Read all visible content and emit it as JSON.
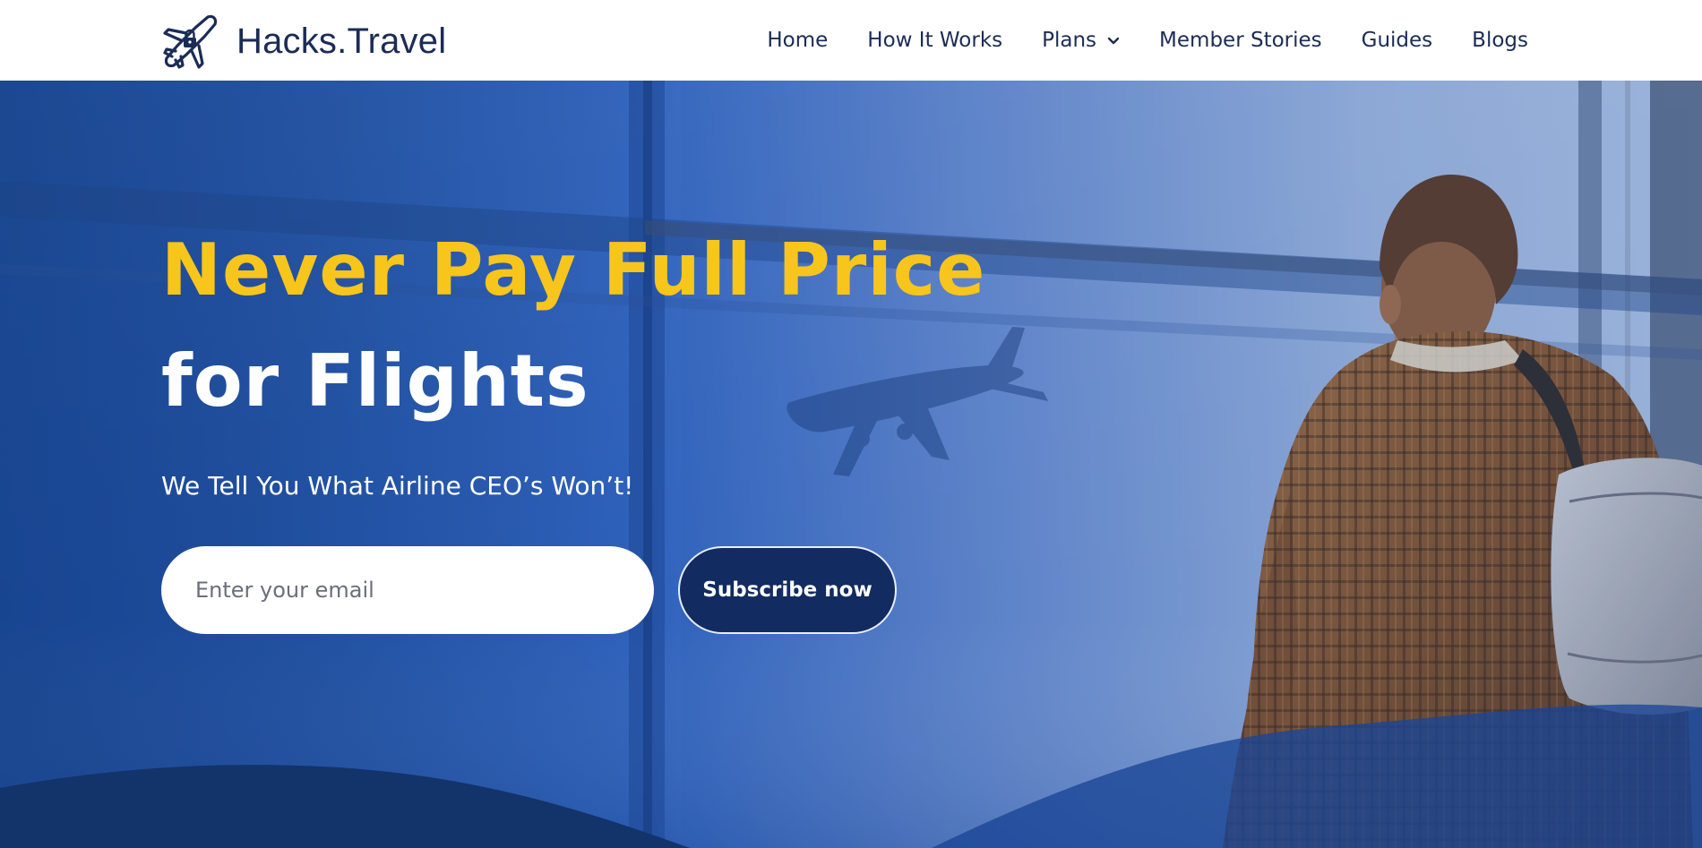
{
  "brand": {
    "name": "Hacks.Travel",
    "logo_icon": "plane-lock-icon",
    "color": "#1b2c55"
  },
  "nav": {
    "items": [
      {
        "label": "Home"
      },
      {
        "label": "How It Works"
      },
      {
        "label": "Plans",
        "icon": "chevron-down-icon"
      },
      {
        "label": "Member Stories"
      },
      {
        "label": "Guides"
      },
      {
        "label": "Blogs"
      }
    ]
  },
  "hero": {
    "title_line1": "Never Pay Full Price",
    "title_line2": "for Flights",
    "subtitle": "We Tell You What Airline CEO’s Won’t!",
    "email_placeholder": "Enter your email",
    "subscribe_label": "Subscribe now"
  },
  "colors": {
    "accent_yellow": "#f7c51c",
    "hero_blue": "#1e4d9e",
    "button_navy": "#122b60",
    "wave_navy": "#13336b"
  }
}
